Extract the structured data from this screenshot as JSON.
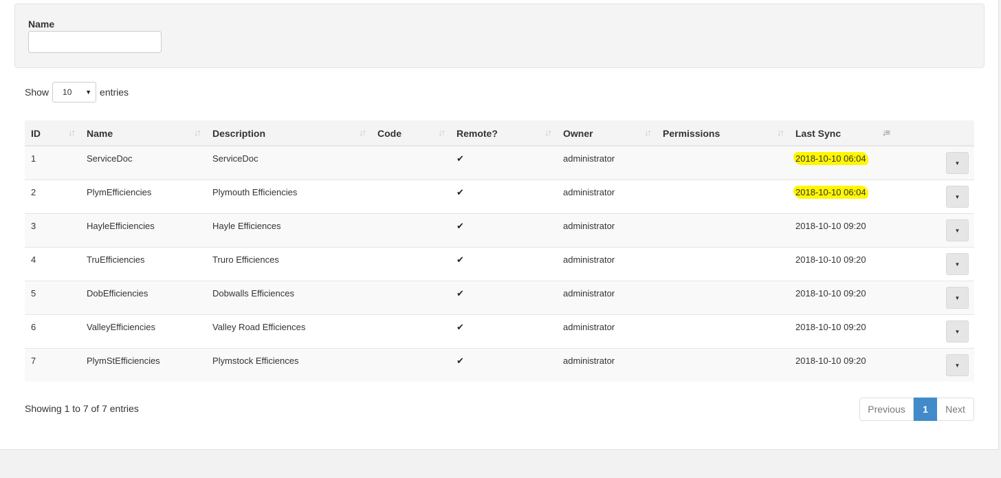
{
  "filter": {
    "name_label": "Name",
    "name_value": "",
    "name_placeholder": ""
  },
  "length": {
    "prefix": "Show",
    "selected": "10",
    "suffix": "entries"
  },
  "table": {
    "columns": [
      "ID",
      "Name",
      "Description",
      "Code",
      "Remote?",
      "Owner",
      "Permissions",
      "Last Sync"
    ],
    "rows": [
      {
        "id": "1",
        "name": "ServiceDoc",
        "description": "ServiceDoc",
        "code": "",
        "remote": "✔",
        "owner": "administrator",
        "permissions": "",
        "last_sync": "2018-10-10 06:04",
        "highlighted": true
      },
      {
        "id": "2",
        "name": "PlymEfficiencies",
        "description": "Plymouth Efficiencies",
        "code": "",
        "remote": "✔",
        "owner": "administrator",
        "permissions": "",
        "last_sync": "2018-10-10 06:04",
        "highlighted": true
      },
      {
        "id": "3",
        "name": "HayleEfficiencies",
        "description": "Hayle Efficiences",
        "code": "",
        "remote": "✔",
        "owner": "administrator",
        "permissions": "",
        "last_sync": "2018-10-10 09:20",
        "highlighted": false
      },
      {
        "id": "4",
        "name": "TruEfficiencies",
        "description": "Truro Efficiences",
        "code": "",
        "remote": "✔",
        "owner": "administrator",
        "permissions": "",
        "last_sync": "2018-10-10 09:20",
        "highlighted": false
      },
      {
        "id": "5",
        "name": "DobEfficiencies",
        "description": "Dobwalls Efficiences",
        "code": "",
        "remote": "✔",
        "owner": "administrator",
        "permissions": "",
        "last_sync": "2018-10-10 09:20",
        "highlighted": false
      },
      {
        "id": "6",
        "name": "ValleyEfficiencies",
        "description": "Valley Road Efficiences",
        "code": "",
        "remote": "✔",
        "owner": "administrator",
        "permissions": "",
        "last_sync": "2018-10-10 09:20",
        "highlighted": false
      },
      {
        "id": "7",
        "name": "PlymStEfficiencies",
        "description": "Plymstock Efficiences",
        "code": "",
        "remote": "✔",
        "owner": "administrator",
        "permissions": "",
        "last_sync": "2018-10-10 09:20",
        "highlighted": false
      }
    ],
    "sort_icon": "sort-both-icon",
    "active_sort_icon": "sort-desc-icon",
    "row_action_icon": "caret-down-icon"
  },
  "info_text": "Showing 1 to 7 of 7 entries",
  "pagination": {
    "previous": "Previous",
    "current": "1",
    "next": "Next"
  },
  "colors": {
    "highlight": "#fff600",
    "primary": "#428bca"
  }
}
